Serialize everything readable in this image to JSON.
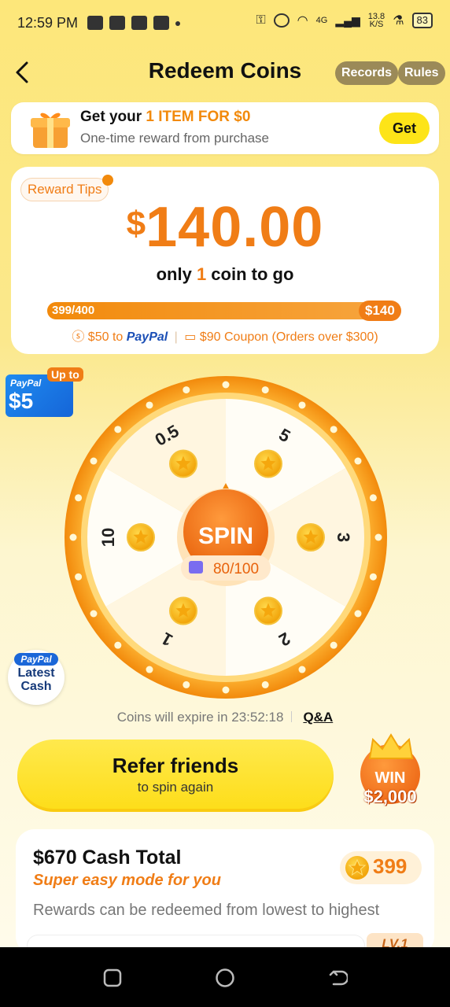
{
  "status_bar": {
    "time": "12:59 PM",
    "network": "4G",
    "speed_top": "13.8",
    "speed_unit": "K/S",
    "battery": "83"
  },
  "header": {
    "title": "Redeem Coins",
    "records_label": "Records",
    "rules_label": "Rules"
  },
  "promo": {
    "prefix": "Get your ",
    "highlight": "1 ITEM FOR $0",
    "subtitle": "One-time reward from purchase",
    "button_label": "Get"
  },
  "reward": {
    "tips_label": "Reward Tips",
    "currency": "$",
    "amount": "140.00",
    "togo_prefix": "only ",
    "togo_count": "1",
    "togo_suffix": " coin to go",
    "progress_label": "399/400",
    "progress_fraction": 0.9975,
    "target_label": "$140",
    "prize_paypal_amount": "$50 to ",
    "prize_paypal_brand": "PayPal",
    "prize_coupon": "$90 Coupon (Orders over $300)"
  },
  "side": {
    "paypal_small": "PayPal",
    "paypal_amount": "$5",
    "upto_label": "Up to",
    "latest_brand": "PayPal",
    "latest_line1": "Latest",
    "latest_line2": "Cash"
  },
  "wheel": {
    "segments": [
      "5",
      "3",
      "2",
      "1",
      "10",
      "0.5"
    ],
    "spin_label": "SPIN",
    "spin_count": "80/100"
  },
  "expire": {
    "text": "Coins will expire in 23:52:18",
    "qa_label": "Q&A"
  },
  "refer": {
    "title": "Refer friends",
    "subtitle": "to spin again"
  },
  "win": {
    "label": "WIN",
    "amount": "$2,000"
  },
  "cash": {
    "title": "$670 Cash Total",
    "subtitle": "Super easy mode for you",
    "description": "Rewards can be redeemed from lowest to highest",
    "coins": "399",
    "level": "LV.1"
  },
  "colors": {
    "accent": "#f07d16",
    "yellow": "#fde418",
    "paypal_blue": "#1b4fb6"
  }
}
